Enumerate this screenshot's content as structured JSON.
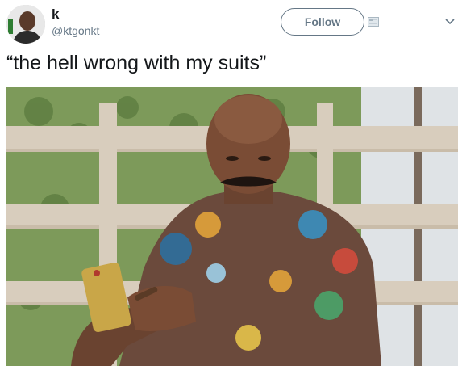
{
  "tweet": {
    "author": {
      "display_name": "k",
      "handle": "@ktgonkt",
      "avatar_icon": "avatar-photo"
    },
    "follow_label": "Follow",
    "text": "“the hell wrong with my suits”",
    "media": {
      "kind": "photo",
      "icon": "photo-man-patterned-shirt-phone"
    }
  },
  "colors": {
    "text_primary": "#14171a",
    "text_secondary": "#657786",
    "background": "#ffffff"
  }
}
